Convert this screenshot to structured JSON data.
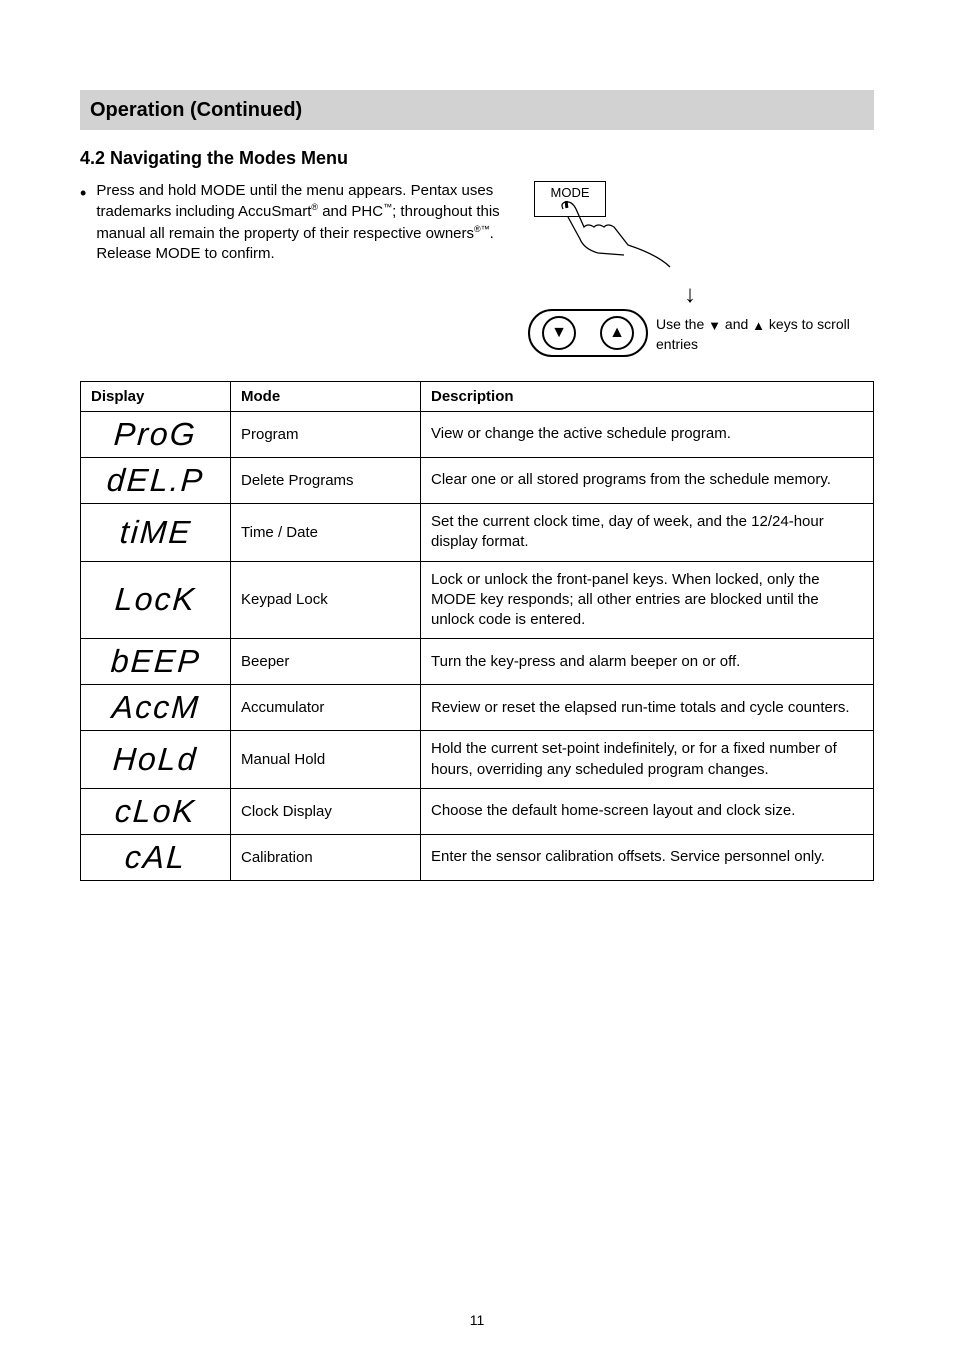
{
  "header": {
    "title": "Operation (Continued)"
  },
  "subhead": "4.2 Navigating the Modes Menu",
  "bullet": "•",
  "para_html": "Press and hold MODE until the menu appears. Pentax uses trademarks including AccuSmart<sup>®</sup> and PHC<sup>™</sup>; throughout this manual all remain the property of their respective owners<sup>®™</sup>. Release MODE to confirm.",
  "mode_label": "MODE",
  "arrow_down": "↓",
  "rocker_text_html": "Use the <span class='tri'>▼</span> and <span class='tri'>▲</span> keys to scroll entries",
  "table": {
    "headers": [
      "Display",
      "Mode",
      "Description"
    ],
    "rows": [
      {
        "icon": "ProG",
        "mode": "Program",
        "desc": "View or change the active schedule program."
      },
      {
        "icon": "dEL.P",
        "mode": "Delete Programs",
        "desc": "Clear one or all stored programs from the schedule memory."
      },
      {
        "icon": "tiME",
        "mode": "Time / Date",
        "desc": "Set the current clock time, day of week, and the 12/24-hour display format."
      },
      {
        "icon": "LocK",
        "mode": "Keypad Lock",
        "desc": "Lock or unlock the front-panel keys. When locked, only the MODE key responds; all other entries are blocked until the unlock code is entered."
      },
      {
        "icon": "bEEP",
        "mode": "Beeper",
        "desc": "Turn the key-press and alarm beeper on or off."
      },
      {
        "icon": "AccM",
        "mode": "Accumulator",
        "desc": "Review or reset the elapsed run-time totals and cycle counters."
      },
      {
        "icon": "HoLd",
        "mode": "Manual Hold",
        "desc": "Hold the current set-point indefinitely, or for a fixed number of hours, overriding any scheduled program changes."
      },
      {
        "icon": "cLoK",
        "mode": "Clock Display",
        "desc": "Choose the default home-screen layout and clock size."
      },
      {
        "icon": "cAL",
        "mode": "Calibration",
        "desc": "Enter the sensor calibration offsets. Service personnel only."
      }
    ]
  },
  "pageno": "11"
}
